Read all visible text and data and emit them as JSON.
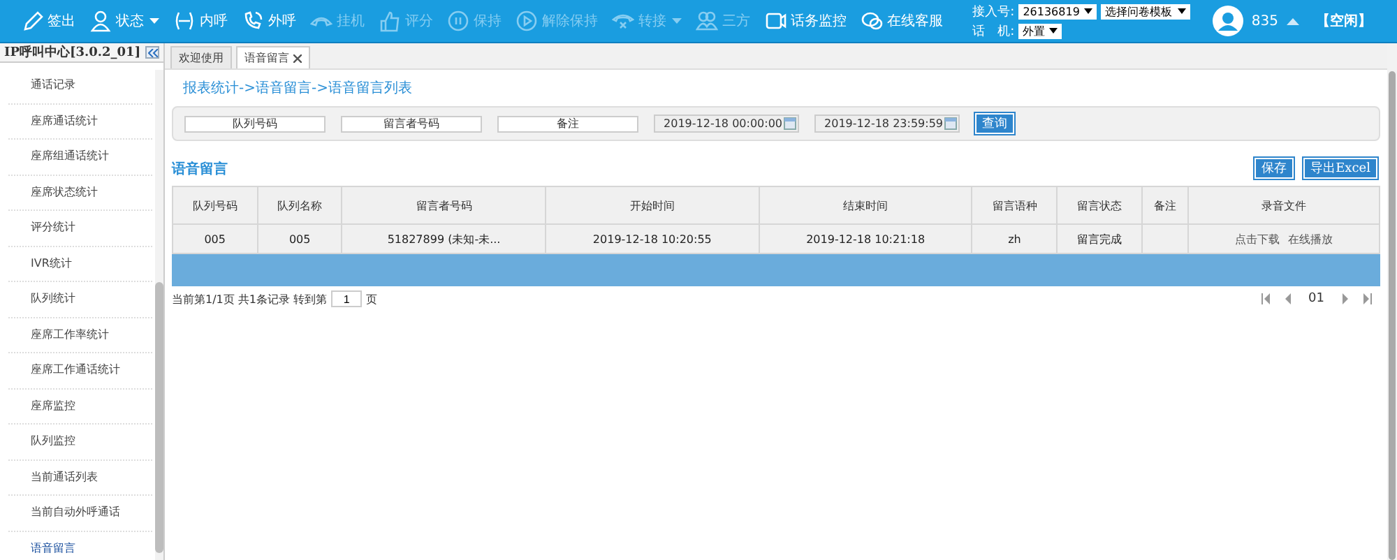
{
  "toolbar": {
    "actions": [
      {
        "label": "签出",
        "disabled": false,
        "menu": false
      },
      {
        "label": "状态",
        "disabled": false,
        "menu": true
      },
      {
        "label": "内呼",
        "disabled": false,
        "menu": false
      },
      {
        "label": "外呼",
        "disabled": false,
        "menu": false
      },
      {
        "label": "挂机",
        "disabled": true,
        "menu": false
      },
      {
        "label": "评分",
        "disabled": true,
        "menu": false
      },
      {
        "label": "保持",
        "disabled": true,
        "menu": false
      },
      {
        "label": "解除保持",
        "disabled": true,
        "menu": false
      },
      {
        "label": "转接",
        "disabled": true,
        "menu": true
      },
      {
        "label": "三方",
        "disabled": true,
        "menu": false
      },
      {
        "label": "话务监控",
        "disabled": false,
        "menu": false
      },
      {
        "label": "在线客服",
        "disabled": false,
        "menu": false
      }
    ],
    "access_label": "接入号:",
    "access_number": "26136819",
    "survey_template": "选择问卷模板",
    "phone_label": "话　机:",
    "phone_mode": "外置",
    "agent_id": "835",
    "agent_status": "【空闲】"
  },
  "sidebar": {
    "title": "IP呼叫中心[3.0.2_01]",
    "items": [
      {
        "label": "通话记录",
        "selected": false
      },
      {
        "label": "座席通话统计",
        "selected": false
      },
      {
        "label": "座席组通话统计",
        "selected": false
      },
      {
        "label": "座席状态统计",
        "selected": false
      },
      {
        "label": "评分统计",
        "selected": false
      },
      {
        "label": "IVR统计",
        "selected": false
      },
      {
        "label": "队列统计",
        "selected": false
      },
      {
        "label": "座席工作率统计",
        "selected": false
      },
      {
        "label": "座席工作通话统计",
        "selected": false
      },
      {
        "label": "座席监控",
        "selected": false
      },
      {
        "label": "队列监控",
        "selected": false
      },
      {
        "label": "当前通话列表",
        "selected": false
      },
      {
        "label": "当前自动外呼通话",
        "selected": false
      },
      {
        "label": "语音留言",
        "selected": true
      }
    ]
  },
  "tabs": [
    {
      "label": "欢迎使用",
      "selected": false,
      "closable": false
    },
    {
      "label": "语音留言",
      "selected": true,
      "closable": true
    }
  ],
  "breadcrumb": "报表统计->语音留言->语音留言列表",
  "filters": [
    {
      "placeholder": "队列号码"
    },
    {
      "placeholder": "留言者号码"
    },
    {
      "placeholder": "备注"
    }
  ],
  "date_range": [
    "2019-12-18 00:00:00",
    "2019-12-18 23:59:59"
  ],
  "search_button": "查询",
  "section_title": "语音留言",
  "actions": [
    "保存",
    "导出Excel"
  ],
  "table": {
    "columns": [
      "队列号码",
      "队列名称",
      "留言者号码",
      "开始时间",
      "结束时间",
      "留言语种",
      "留言状态",
      "备注",
      "录音文件"
    ],
    "rows": [
      {
        "cells": [
          "005",
          "005",
          "51827899 (未知-未...",
          "2019-12-18 10:20:55",
          "2019-12-18 10:21:18",
          "zh",
          "留言完成",
          ""
        ],
        "links": [
          "点击下载",
          "在线播放"
        ]
      }
    ]
  },
  "pagination": {
    "summary": "当前第1/1页 共1条记录 转到第",
    "goto_page": "1",
    "page_suffix": "页",
    "current": "01"
  }
}
